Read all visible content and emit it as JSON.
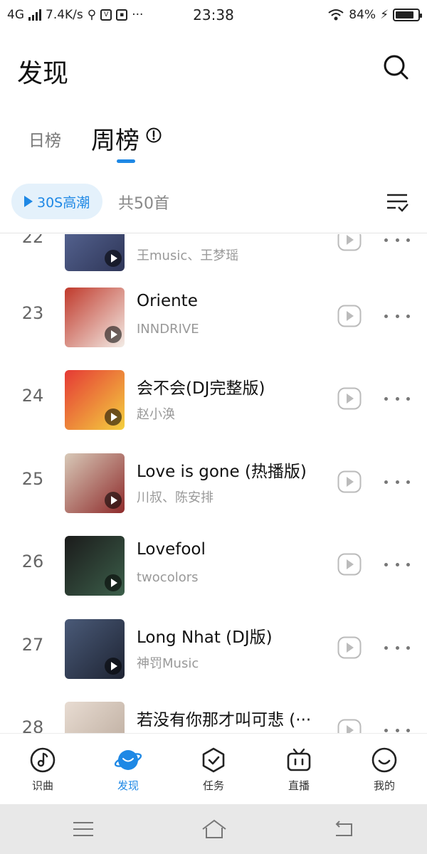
{
  "status_bar": {
    "network": "4G",
    "speed": "7.4K/s",
    "time": "23:38",
    "battery": "84%",
    "battery_level": 0.84,
    "dots": "···"
  },
  "header": {
    "title": "发现"
  },
  "tabs": [
    {
      "label": "日榜",
      "active": false
    },
    {
      "label": "周榜",
      "active": true
    }
  ],
  "toolbar": {
    "highlight_label": "30S高潮",
    "count_label": "共50首"
  },
  "songs": [
    {
      "rank": "22",
      "title": "",
      "artist": "王music、王梦瑶",
      "cover_colors": [
        "#5b6b9a",
        "#2e3557"
      ]
    },
    {
      "rank": "23",
      "title": "Oriente",
      "artist": "INNDRIVE",
      "cover_colors": [
        "#c0392b",
        "#f3ece6"
      ]
    },
    {
      "rank": "24",
      "title": "会不会(DJ完整版)",
      "artist": "赵小涣",
      "cover_colors": [
        "#e53935",
        "#f4d03f"
      ]
    },
    {
      "rank": "25",
      "title": "Love is gone (热播版)",
      "artist": "川叔、陈安排",
      "cover_colors": [
        "#d8c9b8",
        "#8e2b2b"
      ]
    },
    {
      "rank": "26",
      "title": "Lovefool",
      "artist": "twocolors",
      "cover_colors": [
        "#1b1b1b",
        "#3c5f4a"
      ]
    },
    {
      "rank": "27",
      "title": "Long Nhat (DJ版)",
      "artist": "神罚Music",
      "cover_colors": [
        "#4a5a78",
        "#1e2433"
      ]
    },
    {
      "rank": "28",
      "title": "若没有你那才叫可悲 (···",
      "artist": "",
      "cover_colors": [
        "#e8dcd2",
        "#b9a89a"
      ]
    }
  ],
  "bottom_nav": [
    {
      "label": "识曲",
      "icon": "music-note-icon",
      "active": false
    },
    {
      "label": "发现",
      "icon": "planet-icon",
      "active": true
    },
    {
      "label": "任务",
      "icon": "shield-check-icon",
      "active": false
    },
    {
      "label": "直播",
      "icon": "tv-icon",
      "active": false
    },
    {
      "label": "我的",
      "icon": "smiley-icon",
      "active": false
    }
  ],
  "colors": {
    "accent": "#1e88e5",
    "accent_bg": "#e4f1fb",
    "text_secondary": "#999999"
  }
}
